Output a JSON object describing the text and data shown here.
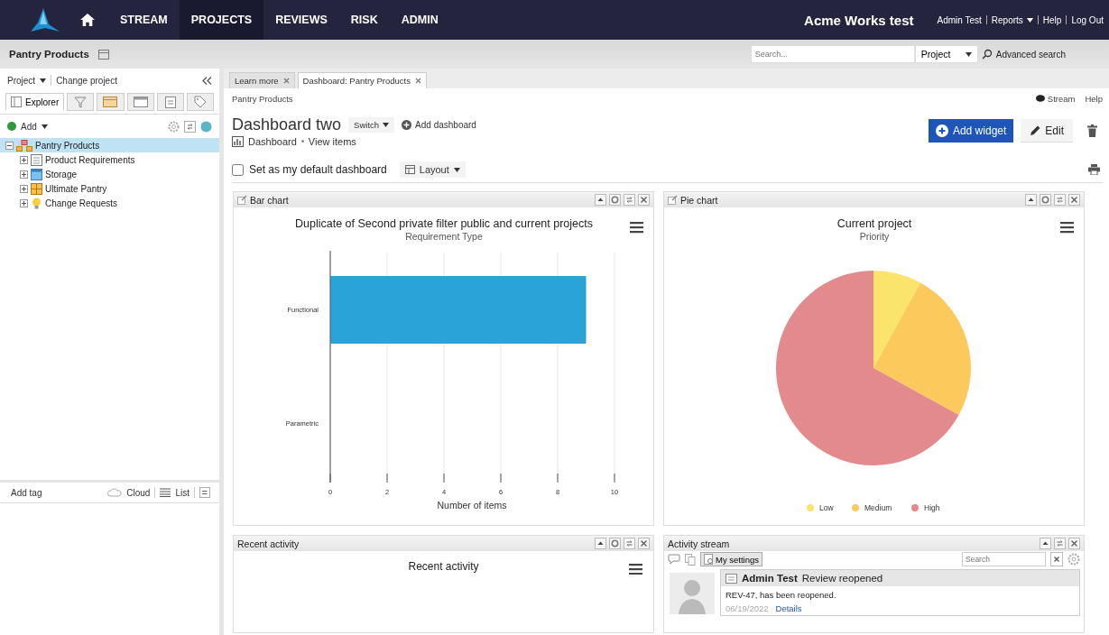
{
  "topbar": {
    "nav": [
      {
        "label": "STREAM",
        "selected": false
      },
      {
        "label": "PROJECTS",
        "selected": true
      },
      {
        "label": "REVIEWS",
        "selected": false
      },
      {
        "label": "RISK",
        "selected": false
      },
      {
        "label": "ADMIN",
        "selected": false
      }
    ],
    "site_title": "Acme Works test",
    "user_links": [
      {
        "label": "Admin Test",
        "dropdown": false
      },
      {
        "label": "Reports",
        "dropdown": true
      },
      {
        "label": "Help",
        "dropdown": false
      },
      {
        "label": "Log Out",
        "dropdown": false
      }
    ]
  },
  "subbar": {
    "project": "Pantry Products",
    "search": {
      "placeholder": "Search..."
    },
    "scope": "Project",
    "advanced_search": "Advanced search"
  },
  "sidebar": {
    "project_menu": "Project",
    "change_project": "Change project",
    "tabs": [
      {
        "kind": "explorer",
        "label": "Explorer",
        "selected": true
      },
      {
        "kind": "filter",
        "selected": false
      },
      {
        "kind": "calendar",
        "selected": false
      },
      {
        "kind": "window",
        "selected": false
      },
      {
        "kind": "clipboard",
        "selected": false
      },
      {
        "kind": "tag",
        "selected": false
      }
    ],
    "add": "Add",
    "tree": [
      {
        "kind": "project",
        "label": "Pantry Products",
        "selected": true,
        "expanded": true,
        "children": [
          {
            "kind": "list",
            "label": "Product Requirements",
            "selected": false,
            "expanded": false
          },
          {
            "kind": "folder",
            "label": "Storage",
            "selected": false,
            "expanded": false
          },
          {
            "kind": "grid",
            "label": "Ultimate Pantry",
            "selected": false,
            "expanded": false
          },
          {
            "kind": "bulb",
            "label": "Change Requests",
            "selected": false,
            "expanded": false
          }
        ]
      }
    ],
    "tags": {
      "add_tag": "Add tag",
      "cloud": "Cloud",
      "list": "List"
    }
  },
  "main": {
    "tabs": [
      {
        "label": "Learn more",
        "selected": false
      },
      {
        "label": "Dashboard: Pantry Products",
        "selected": true
      }
    ],
    "breadcrumb": "Pantry Products",
    "stream": "Stream",
    "help": "Help",
    "title": "Dashboard two",
    "switch": "Switch",
    "add_dashboard": "Add dashboard",
    "add_widget": "Add widget",
    "edit": "Edit",
    "view_links": [
      "Dashboard",
      "View items"
    ],
    "default_dashboard": {
      "label": "Set as my default dashboard",
      "checked": false
    },
    "layout": "Layout",
    "widgets": [
      {
        "kind": "bar",
        "title": "Bar chart",
        "controls": [
          {
            "kind": "collapse"
          },
          {
            "kind": "settings"
          },
          {
            "kind": "refresh"
          },
          {
            "kind": "close"
          }
        ],
        "chart_data": {
          "type": "bar",
          "orientation": "horizontal",
          "title": "Duplicate of Second private filter public and current projects",
          "subtitle": "Requirement Type",
          "xlabel": "Number of items",
          "categories": [
            "Functional",
            "Parametric"
          ],
          "values": [
            9,
            0
          ],
          "xlim": [
            0,
            10
          ],
          "xticks": [
            0,
            2,
            4,
            6,
            8,
            10
          ],
          "grid": true,
          "color": "#2aa3d8"
        }
      },
      {
        "kind": "pie",
        "title": "Pie chart",
        "controls": [
          {
            "kind": "collapse"
          },
          {
            "kind": "settings"
          },
          {
            "kind": "refresh"
          },
          {
            "kind": "close"
          }
        ],
        "chart_data": {
          "type": "pie",
          "title": "Current project",
          "subtitle": "Priority",
          "categories": [
            "Low",
            "Medium",
            "High"
          ],
          "values": [
            8,
            25,
            67
          ],
          "colors": [
            "#fbe46c",
            "#fbc95c",
            "#e38a8c"
          ],
          "legend": true
        }
      },
      {
        "kind": "recent",
        "title": "Recent activity",
        "controls": [
          {
            "kind": "collapse"
          },
          {
            "kind": "settings"
          },
          {
            "kind": "refresh"
          },
          {
            "kind": "close"
          }
        ],
        "heading": "Recent activity"
      },
      {
        "kind": "activity",
        "title": "Activity stream",
        "controls": [
          {
            "kind": "collapse"
          },
          {
            "kind": "refresh"
          },
          {
            "kind": "close"
          }
        ],
        "settings": "My settings",
        "search": {
          "placeholder": "Search"
        },
        "entries": [
          {
            "author": "Admin Test",
            "action": "Review reopened",
            "text": "REV-47, has been reopened.",
            "date": "06/19/2022",
            "link": "Details"
          }
        ]
      }
    ]
  }
}
